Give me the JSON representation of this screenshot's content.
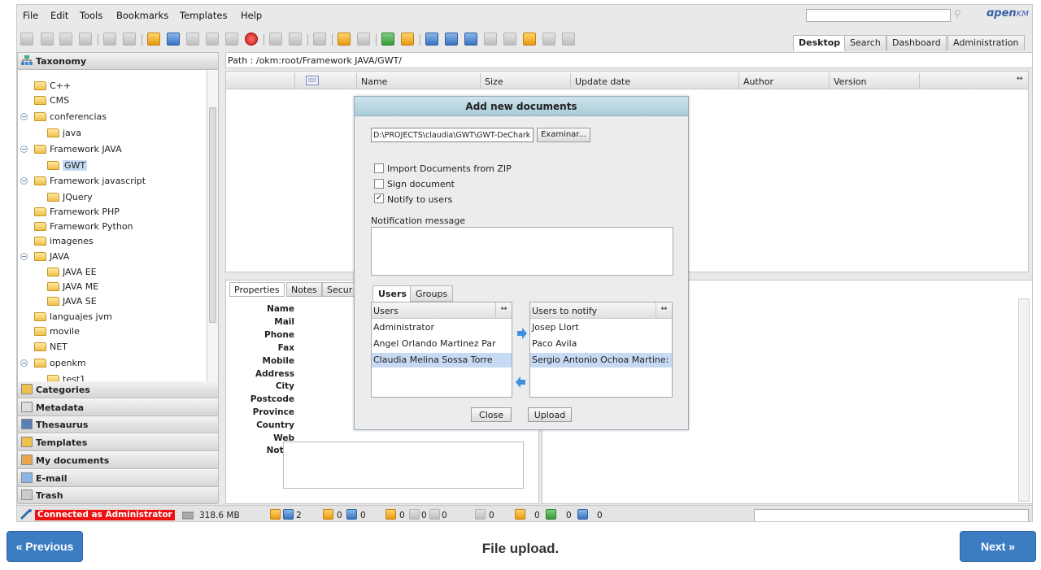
{
  "menu": [
    "File",
    "Edit",
    "Tools",
    "Bookmarks",
    "Templates",
    "Help"
  ],
  "logo": {
    "text": "ɑpen",
    "suffix": "KM"
  },
  "tabs": [
    "Desktop",
    "Search",
    "Dashboard",
    "Administration"
  ],
  "sidebar": {
    "taxonomy_title": "Taxonomy",
    "tree": [
      {
        "label": "C++",
        "indent": 1,
        "toggle": ""
      },
      {
        "label": "CMS",
        "indent": 1,
        "toggle": ""
      },
      {
        "label": "conferencias",
        "indent": 1,
        "toggle": "−"
      },
      {
        "label": "java",
        "indent": 2,
        "toggle": ""
      },
      {
        "label": "Framework JAVA",
        "indent": 1,
        "toggle": "−"
      },
      {
        "label": "GWT",
        "indent": 2,
        "toggle": "",
        "selected": true
      },
      {
        "label": "Framework javascript",
        "indent": 1,
        "toggle": "−"
      },
      {
        "label": "JQuery",
        "indent": 2,
        "toggle": ""
      },
      {
        "label": "Framework PHP",
        "indent": 1,
        "toggle": ""
      },
      {
        "label": "Framework Python",
        "indent": 1,
        "toggle": ""
      },
      {
        "label": "imagenes",
        "indent": 1,
        "toggle": ""
      },
      {
        "label": "JAVA",
        "indent": 1,
        "toggle": "−"
      },
      {
        "label": "JAVA EE",
        "indent": 2,
        "toggle": ""
      },
      {
        "label": "JAVA ME",
        "indent": 2,
        "toggle": ""
      },
      {
        "label": "JAVA SE",
        "indent": 2,
        "toggle": ""
      },
      {
        "label": "languajes jvm",
        "indent": 1,
        "toggle": ""
      },
      {
        "label": "movile",
        "indent": 1,
        "toggle": ""
      },
      {
        "label": "NET",
        "indent": 1,
        "toggle": ""
      },
      {
        "label": "openkm",
        "indent": 1,
        "toggle": "−"
      },
      {
        "label": "test1",
        "indent": 2,
        "toggle": ""
      }
    ],
    "sections": [
      "Categories",
      "Metadata",
      "Thesaurus",
      "Templates",
      "My documents",
      "E-mail",
      "Trash"
    ]
  },
  "path": "Path : /okm:root/Framework JAVA/GWT/",
  "filelist": {
    "columns": [
      "Name",
      "Size",
      "Update date",
      "Author",
      "Version"
    ]
  },
  "properties": {
    "tabs": [
      "Properties",
      "Notes",
      "Secur"
    ],
    "labels": [
      "Name",
      "Mail",
      "Phone",
      "Fax",
      "Mobile",
      "Address",
      "City",
      "Postcode",
      "Province",
      "Country",
      "Web",
      "Notes"
    ]
  },
  "dialog": {
    "title": "Add new documents",
    "file_value": "D:\\PROJECTS\\claudia\\GWT\\GWT-DeChark",
    "browse_label": "Examinar...",
    "checks": [
      {
        "label": "Import Documents from ZIP",
        "checked": false
      },
      {
        "label": "Sign document",
        "checked": false
      },
      {
        "label": "Notify to users",
        "checked": true
      }
    ],
    "message_label": "Notification message",
    "tabs": [
      "Users",
      "Groups"
    ],
    "users_header": "Users",
    "notify_header": "Users to notify",
    "users": [
      "Administrator",
      "Angel Orlando Martinez Par",
      "Claudia Melina Sossa Torre"
    ],
    "notify": [
      "Josep Llort",
      "Paco Avila",
      "Sergio Antonio Ochoa Martine:"
    ],
    "close_label": "Close",
    "upload_label": "Upload"
  },
  "status": {
    "connected": "Connected as Administrator",
    "size": "318.6 MB",
    "counts": [
      "2",
      "0",
      "0",
      "0",
      "0",
      "0",
      "0",
      "0",
      "0",
      "0"
    ]
  },
  "nav": {
    "previous": "« Previous",
    "next": "Next »",
    "caption": "File upload."
  }
}
